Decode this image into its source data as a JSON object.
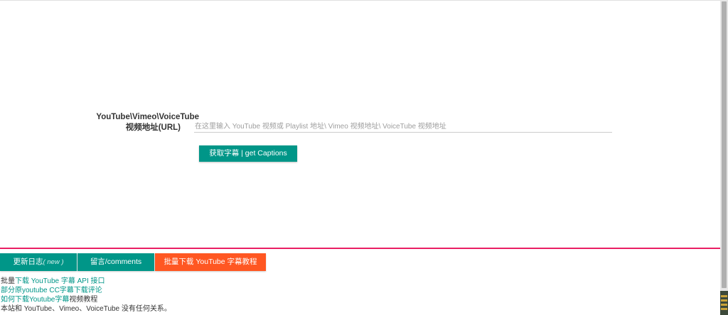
{
  "form": {
    "label_line1": "YouTube\\Vimeo\\VoiceTube",
    "label_line2": "视频地址(URL)",
    "url_placeholder": "在这里输入 YouTube 视频或 Playlist 地址\\ Vimeo 视频地址\\ VoiceTube 视频地址",
    "url_value": "",
    "submit_label": "获取字幕 | get Captions"
  },
  "tabs": [
    {
      "label": "更新日志",
      "badge": "( new )",
      "color": "#009688"
    },
    {
      "label": "留言/comments",
      "color": "#009688"
    },
    {
      "label": "批量下载 YouTube 字幕教程",
      "color": "#ff5722"
    }
  ],
  "links": {
    "api_prefix": "批量",
    "api_link": "下载 YouTube 字幕 API 接口",
    "comments_prefix": "部分原",
    "comments_link": "youtube CC字幕下载评论",
    "tutorial_prefix": "如何下载",
    "tutorial_link": "Youtube字幕",
    "tutorial_suffix": "视频教程",
    "disclaimer": "本站和 YouTube、Vimeo、VoiceTube 没有任何关系。"
  },
  "colors": {
    "primary": "#009688",
    "accent": "#ff5722",
    "divider": "#e91e63"
  }
}
